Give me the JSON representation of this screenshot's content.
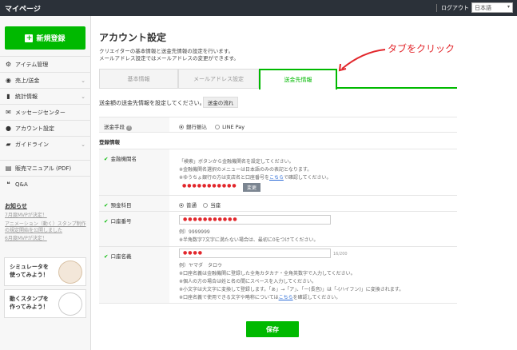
{
  "topbar": {
    "title": "マイページ",
    "logout": "ログアウト",
    "lang": "日本語"
  },
  "sidebar": {
    "new_button": "新規登録",
    "items": [
      {
        "label": "アイテム管理",
        "icon": "gear-icon"
      },
      {
        "label": "売上/送金",
        "icon": "coins-icon"
      },
      {
        "label": "統計情報",
        "icon": "chart-icon"
      },
      {
        "label": "メッセージセンター",
        "icon": "mail-icon"
      },
      {
        "label": "アカウント設定",
        "icon": "person-icon"
      },
      {
        "label": "ガイドライン",
        "icon": "folder-icon"
      },
      {
        "label": "販売マニュアル (PDF)",
        "icon": "book-icon"
      },
      {
        "label": "Q&A",
        "icon": "chat-icon"
      }
    ],
    "news": {
      "heading": "お知らせ",
      "items": [
        "7月度MVPが決定！",
        "アニメーション（動く）スタンプ制作の規定開始を公開しました",
        "6月度MVPが決定！"
      ]
    },
    "banners": [
      {
        "line1": "シミュレータを",
        "line2": "使ってみよう！"
      },
      {
        "line1": "動くスタンプを",
        "line2": "作ってみよう！"
      }
    ]
  },
  "page": {
    "title": "アカウント設定",
    "desc1": "クリエイターの基本情報と送金先情報の設定を行います。",
    "desc2": "メールアドレス設定ではメールアドレスの変更ができます。"
  },
  "tabs": [
    "基本情報",
    "メールアドレス設定",
    "送金先情報"
  ],
  "annotation": "タブをクリック",
  "colors": {
    "accent": "#00b900",
    "annotation": "#e2262b",
    "topbar": "#2b3139"
  },
  "form": {
    "intro": "送金額の送金先情報を設定してください。",
    "flow_button": "送金の流れ",
    "method_label": "送金手段",
    "method_options": [
      "銀行振込",
      "LINE Pay"
    ],
    "registration_heading": "登録情報",
    "bank_label": "金融機関名",
    "bank_note1": "「検索」ボタンから金融機関名を設定してください。",
    "bank_note2": "※金融機関名選択のメニューは日本語のみの表記となります。",
    "bank_note3_pre": "※ゆうちょ銀行の方は支店名と口座番号を",
    "bank_note3_link": "こちら",
    "bank_note3_post": "で確認してください。",
    "bank_value": "●●●●●●●●●●●",
    "change_button": "変更",
    "type_label": "預金科目",
    "type_options": [
      "普通",
      "当座"
    ],
    "account_no_label": "口座番号",
    "account_no_value": "●●●●●●●●●●●",
    "account_no_example": "例）9999999",
    "account_no_note": "※半角数字7文字に満たない場合は、最初に0をつけてください。",
    "holder_label": "口座名義",
    "holder_value": "●●●●",
    "holder_count": "16/200",
    "holder_example": "例）ヤマダ　タロウ",
    "holder_note1": "※口座名義は金融機関に登録した全角カタカナ・全角英数字で入力してください。",
    "holder_note2": "※個人の方の場合は姓と名の間にスペースを入力してください。",
    "holder_note3": "※小文字は大文字に変換して登録します。「ぁ」→「ア」、「ー(長音)」は「-(ハイフン)」に変換されます。",
    "holder_note4_pre": "※口座名義で使用できる文字や略称については",
    "holder_note4_link": "こちら",
    "holder_note4_post": "を確認してください。",
    "save_button": "保存"
  }
}
